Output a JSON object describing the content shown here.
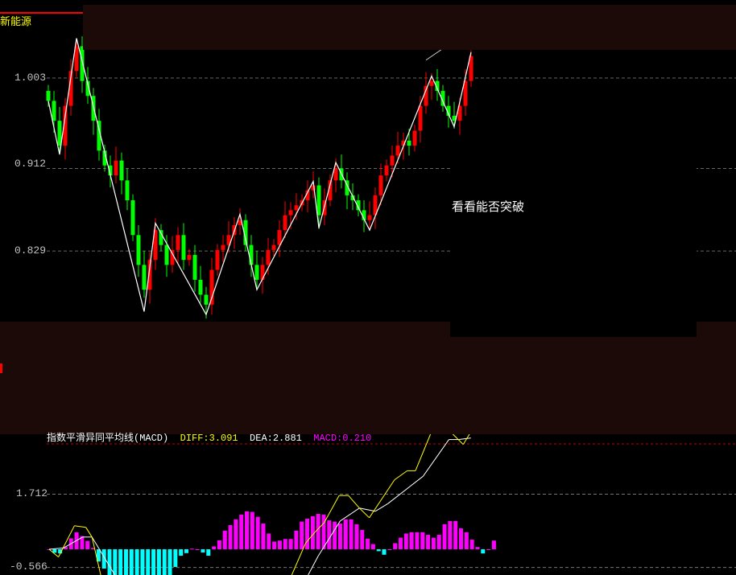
{
  "header": {
    "title": "新能源"
  },
  "annotation": "看看能否突破",
  "macd_header": {
    "name": "指数平滑异同平均线(MACD)",
    "diff": "DIFF:3.091",
    "dea": "DEA:2.881",
    "macd": "MACD:0.210"
  },
  "colors": {
    "up": "#ff0000",
    "down": "#00ff00",
    "diff": "#ffff00",
    "dea": "#ffffff",
    "hist_pos": "#ff00ff",
    "hist_neg": "#00ffff",
    "band": "#1c0a08"
  },
  "chart_data": [
    {
      "type": "candlestick",
      "title": "新能源",
      "yticks": [
        "1.003",
        "0.912",
        "0.829"
      ],
      "ytick_values": [
        1.003,
        0.912,
        0.829
      ],
      "closes": [
        0.98,
        0.96,
        0.935,
        0.975,
        1.01,
        1.035,
        1.0,
        0.985,
        0.96,
        0.93,
        0.915,
        0.905,
        0.92,
        0.9,
        0.88,
        0.845,
        0.815,
        0.79,
        0.82,
        0.85,
        0.835,
        0.815,
        0.83,
        0.845,
        0.82,
        0.825,
        0.8,
        0.785,
        0.775,
        0.81,
        0.83,
        0.835,
        0.845,
        0.855,
        0.86,
        0.835,
        0.815,
        0.8,
        0.815,
        0.83,
        0.835,
        0.85,
        0.865,
        0.87,
        0.875,
        0.88,
        0.89,
        0.895,
        0.865,
        0.88,
        0.9,
        0.912,
        0.9,
        0.885,
        0.88,
        0.87,
        0.86,
        0.865,
        0.885,
        0.905,
        0.915,
        0.925,
        0.935,
        0.94,
        0.935,
        0.95,
        0.975,
        0.995,
        1.0,
        0.99,
        0.975,
        0.965,
        0.96,
        0.975,
        1.0,
        1.025
      ],
      "zigzag": [
        [
          0,
          0.98
        ],
        [
          2,
          0.926
        ],
        [
          5,
          1.043
        ],
        [
          17,
          0.768
        ],
        [
          19,
          0.857
        ],
        [
          28,
          0.765
        ],
        [
          34,
          0.866
        ],
        [
          37,
          0.79
        ],
        [
          47,
          0.899
        ],
        [
          48,
          0.852
        ],
        [
          51,
          0.918
        ],
        [
          57,
          0.85
        ],
        [
          68,
          1.005
        ],
        [
          72,
          0.954
        ],
        [
          75,
          1.029
        ]
      ],
      "trendline": [
        [
          67,
          1.021
        ],
        [
          75,
          1.052
        ]
      ]
    },
    {
      "type": "macd",
      "yticks": [
        "1.712",
        "-0.566"
      ],
      "ytick_values": [
        1.712,
        -0.566
      ],
      "histogram": [
        0,
        -0.11,
        -0.13,
        0.07,
        0.34,
        0.53,
        0.41,
        0.26,
        0.04,
        -0.38,
        -0.6,
        -0.8,
        -0.85,
        -1.0,
        -1.1,
        -1.2,
        -1.3,
        -1.3,
        -1.3,
        -1.3,
        -1.25,
        -1.2,
        -1.0,
        -0.55,
        -0.2,
        -0.12,
        0.02,
        0,
        -0.1,
        -0.2,
        0.09,
        0.28,
        0.58,
        0.75,
        0.93,
        1.08,
        1.18,
        1.16,
        1.01,
        0.8,
        0.49,
        0.24,
        0.27,
        0.32,
        0.32,
        0.58,
        0.86,
        0.95,
        1.03,
        1.1,
        1.08,
        0.9,
        0.86,
        0.8,
        0.93,
        0.93,
        0.78,
        0.6,
        0.33,
        0.16,
        -0.06,
        -0.17,
        0,
        0.19,
        0.36,
        0.49,
        0.53,
        0.53,
        0.53,
        0.45,
        0.36,
        0.45,
        0.78,
        0.88,
        0.88,
        0.65,
        0.53,
        0.3,
        0.07,
        -0.13,
        0,
        0.27
      ],
      "diff": [
        [
          0,
          0
        ],
        [
          1.7,
          -0.24
        ],
        [
          4.6,
          0.73
        ],
        [
          6.7,
          0.68
        ],
        [
          7.8,
          0.38
        ],
        [
          9.6,
          -0.95
        ],
        [
          25.8,
          -3.2
        ],
        [
          43.8,
          -0.95
        ],
        [
          46.7,
          0.19
        ],
        [
          48.4,
          0.53
        ],
        [
          50.1,
          0.83
        ],
        [
          52.8,
          1.67
        ],
        [
          54.5,
          1.67
        ],
        [
          56.5,
          1.28
        ],
        [
          58.3,
          0.98
        ],
        [
          62.9,
          2.16
        ],
        [
          65.2,
          2.44
        ],
        [
          66.7,
          2.44
        ],
        [
          70.1,
          3.85
        ],
        [
          72.2,
          3.8
        ],
        [
          75.4,
          3.26
        ],
        [
          76.8,
          3.65
        ]
      ],
      "dea": [
        [
          0,
          0
        ],
        [
          2.6,
          0.04
        ],
        [
          6.1,
          0.38
        ],
        [
          7.8,
          0.38
        ],
        [
          12.5,
          -0.95
        ],
        [
          25.8,
          -2.3
        ],
        [
          46.7,
          -0.95
        ],
        [
          49,
          -0.21
        ],
        [
          53,
          0.88
        ],
        [
          56.5,
          1.28
        ],
        [
          59.4,
          1.18
        ],
        [
          61.7,
          1.42
        ],
        [
          68.1,
          2.27
        ],
        [
          72.8,
          3.41
        ],
        [
          74.5,
          3.41
        ],
        [
          76.8,
          3.46
        ]
      ],
      "trendline": [
        [
          72,
          4.05
        ],
        [
          79,
          3.78
        ]
      ]
    }
  ]
}
